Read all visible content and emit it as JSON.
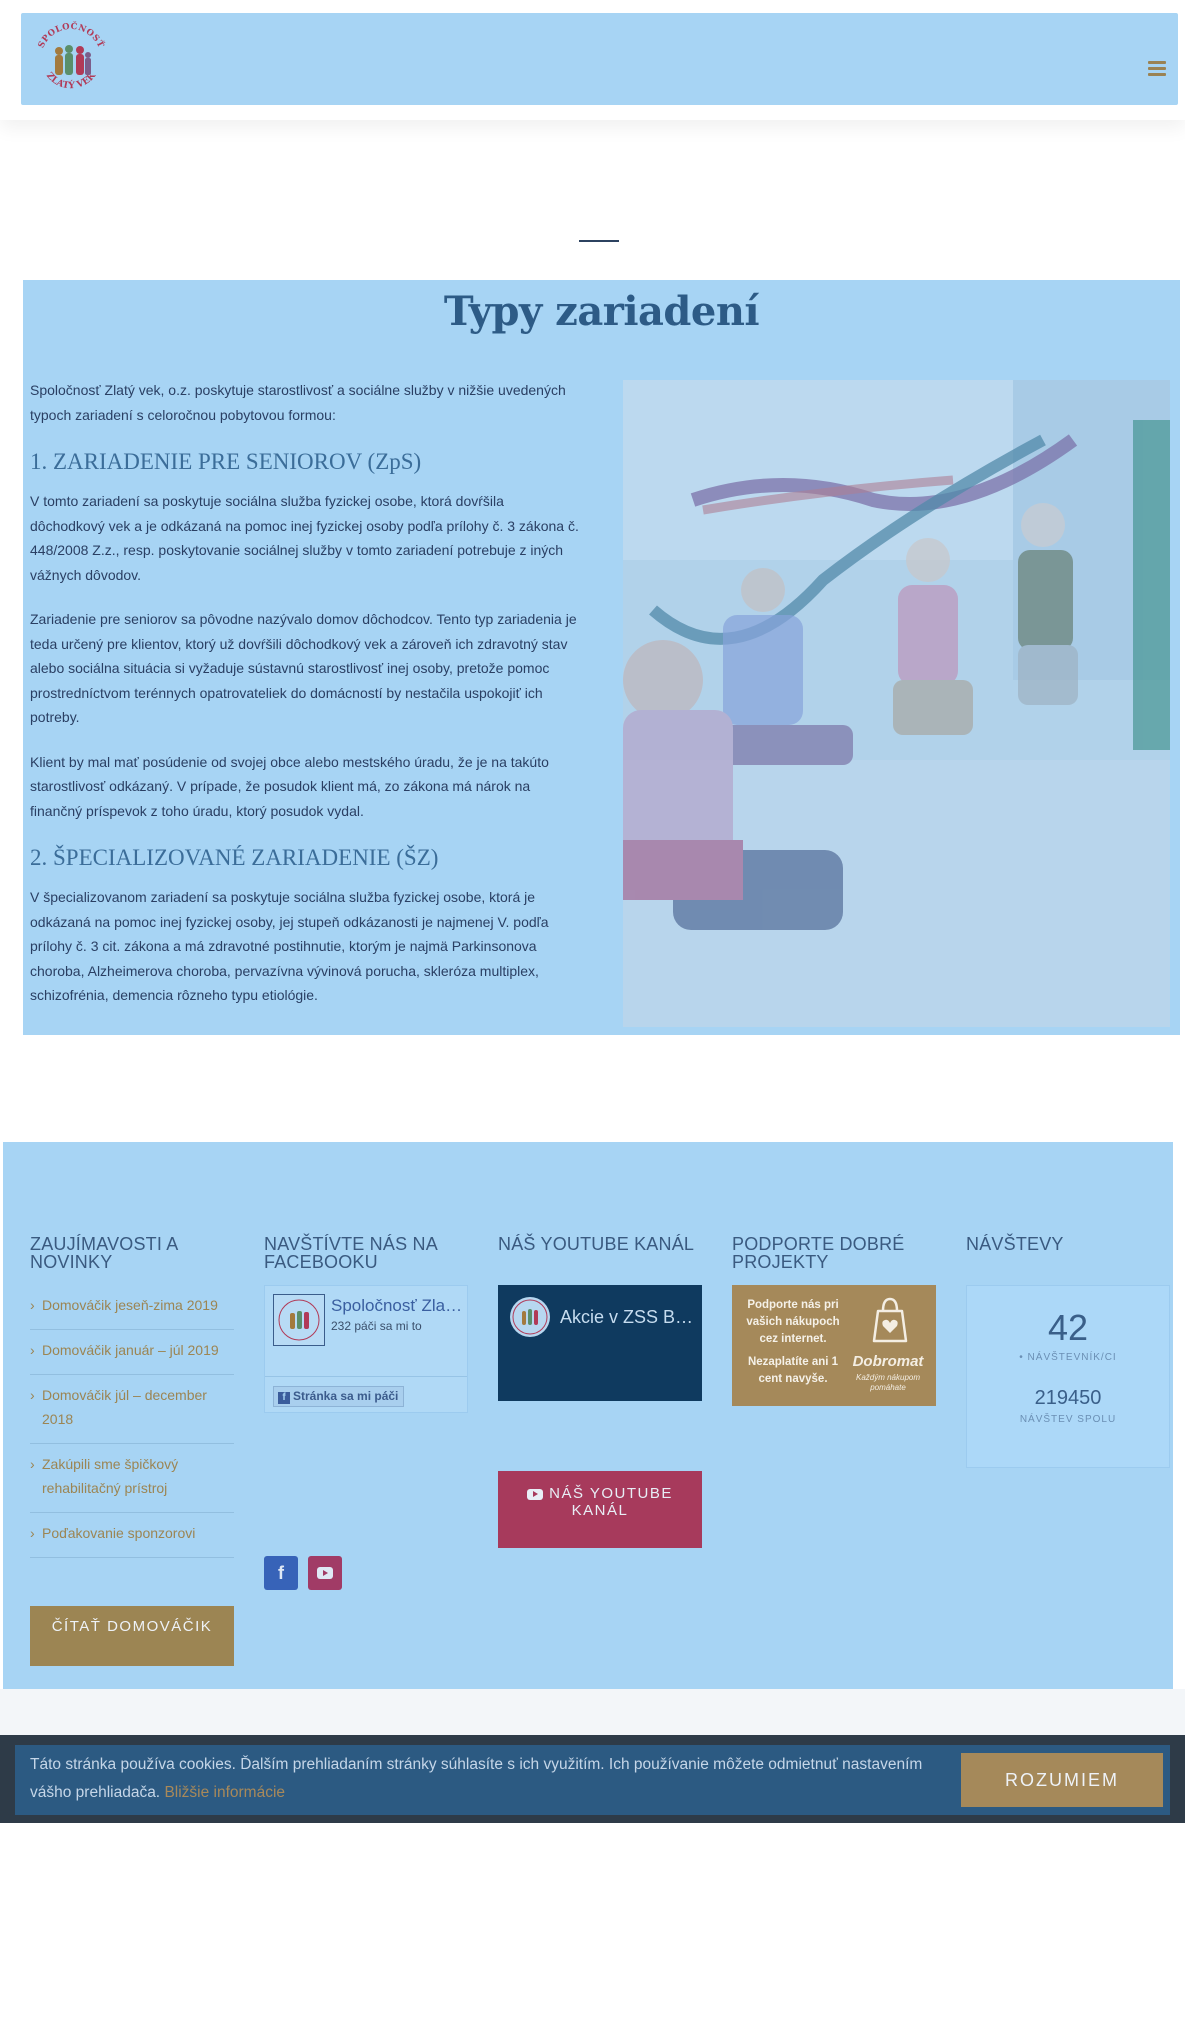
{
  "header": {
    "logo_alt": "Spoločnosť Zlatý vek",
    "logo_line1": "SPOLOČNOSŤ",
    "logo_line2": "ZLATÝ VEK",
    "menu_icon": "hamburger-menu-icon"
  },
  "main": {
    "title": "Typy zariadení",
    "intro": "Spoločnosť Zlatý vek, o.z. poskytuje starostlivosť a sociálne služby v nižšie uvedených typoch zariadení s celoročnou pobytovou formou:",
    "section1_heading": "1. ZARIADENIE PRE SENIOROV (ZpS)",
    "section1_p1": "V tomto zariadení sa poskytuje sociálna služba fyzickej osobe, ktorá dovŕšila dôchodkový vek a je odkázaná na pomoc inej fyzickej osoby podľa prílohy č. 3 zákona č. 448/2008 Z.z., resp. poskytovanie sociálnej služby v tomto zariadení potrebuje z iných vážnych dôvodov.",
    "section1_p2": "Zariadenie pre seniorov sa pôvodne nazývalo domov dôchodcov. Tento typ zariadenia je teda určený pre klientov, ktorý už dovŕšili dôchodkový vek a zároveň ich zdravotný stav alebo sociálna situácia si vyžaduje sústavnú starostlivosť inej osoby, pretože pomoc prostredníctvom terénnych opatrovateliek do domácností by nestačila uspokojiť ich potreby.",
    "section1_p3": "Klient by mal mať posúdenie od svojej obce alebo mestského úradu, že je na takúto starostlivosť odkázaný. V prípade, že posudok klient má, zo zákona má nárok na finančný príspevok z toho úradu, ktorý posudok vydal.",
    "section2_heading": "2. ŠPECIALIZOVANÉ ZARIADENIE (ŠZ)",
    "section2_p1": "V špecializovanom zariadení sa poskytuje sociálna služba fyzickej osobe, ktorá je odkázaná na pomoc inej fyzickej osoby, jej stupeň odkázanosti je najmenej V. podľa prílohy č. 3 cit. zákona a má zdravotné postihnutie, ktorým je najmä Parkinsonova choroba, Alzheimerova choroba, pervazívna vývinová porucha, skleróza multiplex, schizofrénia, demencia rôzneho typu etiológie."
  },
  "footer": {
    "news": {
      "heading": "ZAUJÍMAVOSTI A NOVINKY",
      "items": [
        "Domováčik jeseň-zima 2019",
        "Domováčik január – júl 2019",
        "Domováčik júl – december 2018",
        "Zakúpili sme špičkový rehabilitačný prístroj",
        "Poďakovanie sponzorovi"
      ],
      "button": "ČÍTAŤ DOMOVÁČIK"
    },
    "facebook": {
      "heading": "NAVŠTÍVTE NÁS NA FACEBOOKU",
      "page_name": "Spoločnosť Zlatý vek",
      "likes": "232 páči sa mi to",
      "like_button": "Stránka sa mi páči"
    },
    "youtube": {
      "heading": "NÁŠ YOUTUBE KANÁL",
      "video_title": "Akcie v ZSS Bernolákovo",
      "button": "NÁŠ YOUTUBE KANÁL"
    },
    "support": {
      "heading": "PODPORTE DOBRÉ PROJEKTY",
      "banner_text1": "Podporte nás pri vašich nákupoch cez internet.",
      "banner_text2": "Nezaplatíte ani 1 cent navyše.",
      "brand": "Dobromat",
      "brand_sub": "Každým nákupom pomáhate"
    },
    "visits": {
      "heading": "NÁVŠTEVY",
      "current": "42",
      "current_label": "• NÁVŠTEVNÍK/CI",
      "total": "219450",
      "total_label": "NÁVŠTEV SPOLU"
    },
    "colors": {
      "facebook": "#3763b8",
      "youtube": "#a13b66",
      "gold": "#9c8553"
    }
  },
  "cookie": {
    "text": "Táto stránka používa cookies. Ďalším prehliadaním stránky súhlasíte s ich využitím. Ich používanie môžete odmietnuť nastavením vášho prehliadača.",
    "link": "Bližšie informácie",
    "button": "ROZUMIEM"
  }
}
